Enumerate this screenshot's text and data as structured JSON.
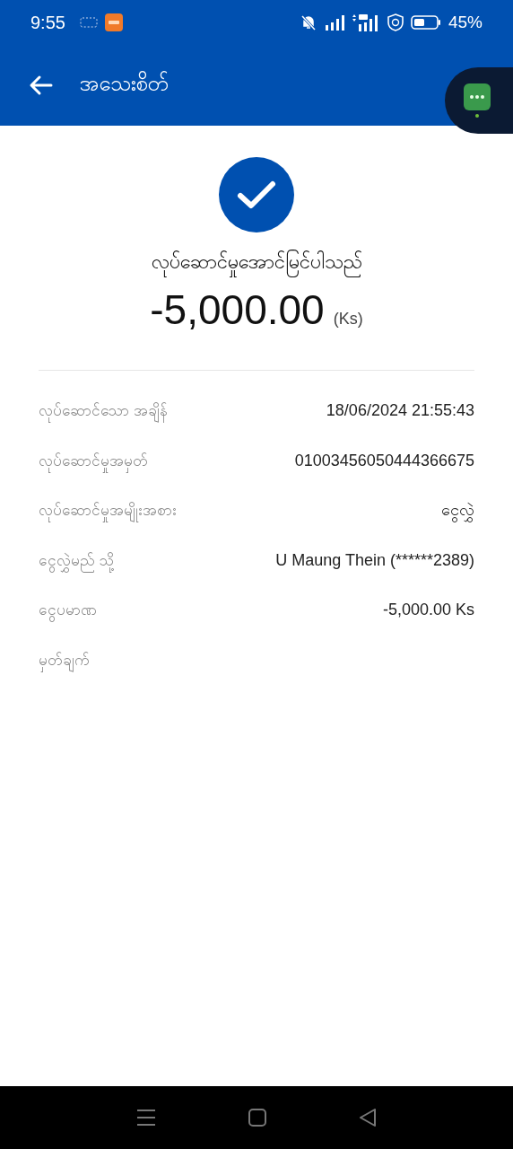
{
  "status_bar": {
    "time": "9:55",
    "battery": "45%"
  },
  "app_bar": {
    "title": "အသေးစိတ်"
  },
  "result": {
    "message": "လုပ်ဆောင်မှုအောင်မြင်ပါသည်",
    "amount": "-5,000.00",
    "currency": "(Ks)"
  },
  "details": [
    {
      "label": "လုပ်ဆောင်သော အချိန်",
      "value": "18/06/2024 21:55:43"
    },
    {
      "label": "လုပ်ဆောင်မှုအမှတ်",
      "value": "01003456050444366675"
    },
    {
      "label": "လုပ်ဆောင်မှုအမျိုးအစား",
      "value": "ငွေလွှဲ"
    },
    {
      "label": "ငွေလွှဲမည် သို့",
      "value": "U Maung Thein (******2389)"
    },
    {
      "label": "ငွေပမာဏ",
      "value": "-5,000.00 Ks"
    },
    {
      "label": "မှတ်ချက်"
    }
  ]
}
